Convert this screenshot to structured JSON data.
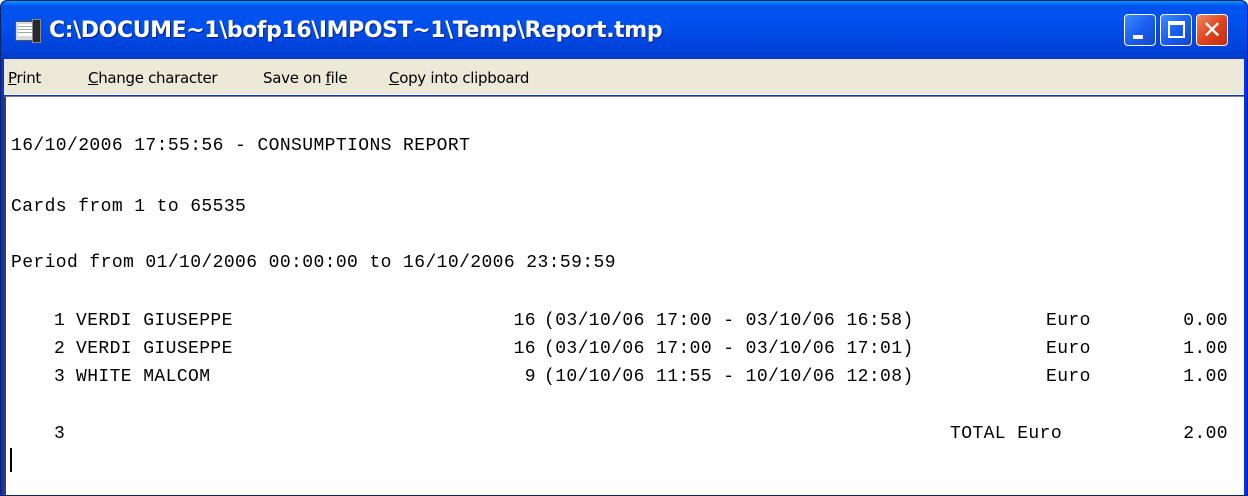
{
  "window": {
    "title": "C:\\DOCUME~1\\bofp16\\IMPOST~1\\Temp\\Report.tmp",
    "icon": "notepad-icon",
    "controls": {
      "minimize_icon": "minimize-icon",
      "maximize_icon": "maximize-icon",
      "close_glyph": "✕"
    }
  },
  "menu": {
    "items": [
      {
        "label": "Print",
        "mnemonic": "P"
      },
      {
        "label": "Change character",
        "mnemonic": "C"
      },
      {
        "label": "Save on file",
        "mnemonic": "f"
      },
      {
        "label": "Copy into clipboard",
        "mnemonic": "C"
      }
    ]
  },
  "report": {
    "header": "16/10/2006 17:55:56 - CONSUMPTIONS REPORT",
    "cards": "Cards from 1 to 65535",
    "period": "Period from 01/10/2006 00:00:00 to 16/10/2006 23:59:59",
    "rows": [
      {
        "num": "1",
        "name": "VERDI GIUSEPPE",
        "qty": "16",
        "period": "(03/10/06 17:00 - 03/10/06 16:58)",
        "currency": "Euro",
        "amount": "0.00"
      },
      {
        "num": "2",
        "name": "VERDI GIUSEPPE",
        "qty": "16",
        "period": "(03/10/06 17:00 - 03/10/06 17:01)",
        "currency": "Euro",
        "amount": "1.00"
      },
      {
        "num": "3",
        "name": "WHITE MALCOM",
        "qty": "9",
        "period": "(10/10/06 11:55 - 10/10/06 12:08)",
        "currency": "Euro",
        "amount": "1.00"
      }
    ],
    "total": {
      "count": "3",
      "label": "TOTAL Euro",
      "amount": "2.00"
    }
  },
  "colors": {
    "titlebar": "#0053ee",
    "menubar": "#ece9d8",
    "client": "#ffffff",
    "close_button": "#e0451f"
  }
}
